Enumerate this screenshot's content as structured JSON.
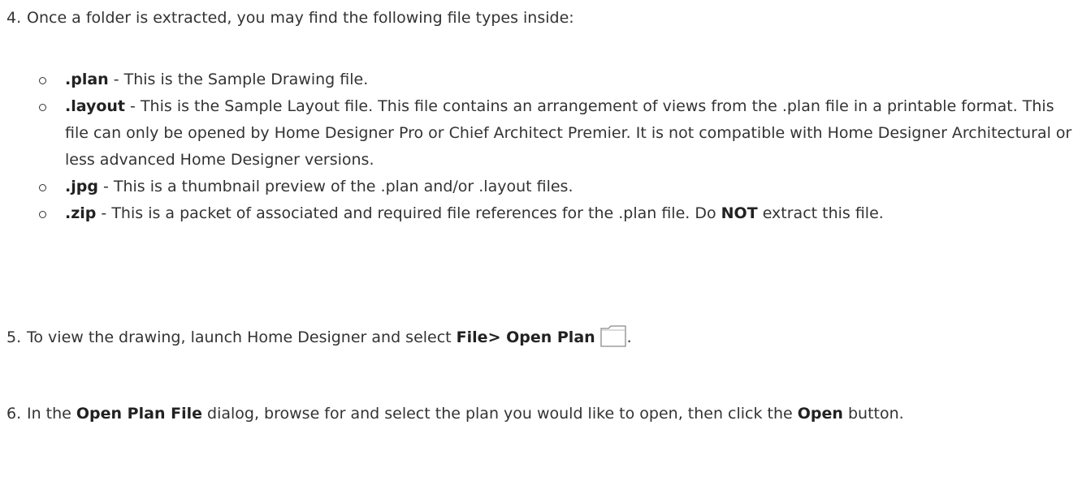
{
  "steps": [
    {
      "num": "4.",
      "text": "Once a folder is extracted, you may find the following file types inside:"
    },
    {
      "num": "5.",
      "text_before": "To view the drawing, launch Home Designer and select ",
      "bold": "File> Open Plan",
      "text_after": "."
    },
    {
      "num": "6.",
      "text_before": "In the ",
      "bold1": "Open Plan File",
      "text_mid": " dialog, browse for and select the plan you would like to open, then click the ",
      "bold2": "Open",
      "text_after": " button."
    }
  ],
  "file_types": [
    {
      "ext": ".plan",
      "desc": " -  This is the Sample Drawing file."
    },
    {
      "ext": ".layout",
      "desc": " - This is the Sample Layout file. This file contains an arrangement of views from the .plan file in a printable format. This file can only be opened by Home Designer Pro or Chief Architect Premier. It is not compatible with Home Designer Architectural or less advanced Home Designer versions."
    },
    {
      "ext": ".jpg",
      "desc": " - This is a thumbnail preview of the .plan and/or .layout files."
    },
    {
      "ext": ".zip",
      "desc_before": " - This is a packet of associated and required file references for the .plan file. Do ",
      "bold": "NOT",
      "desc_after": " extract this file."
    }
  ],
  "icons": {
    "open_plan": "folder-icon"
  }
}
